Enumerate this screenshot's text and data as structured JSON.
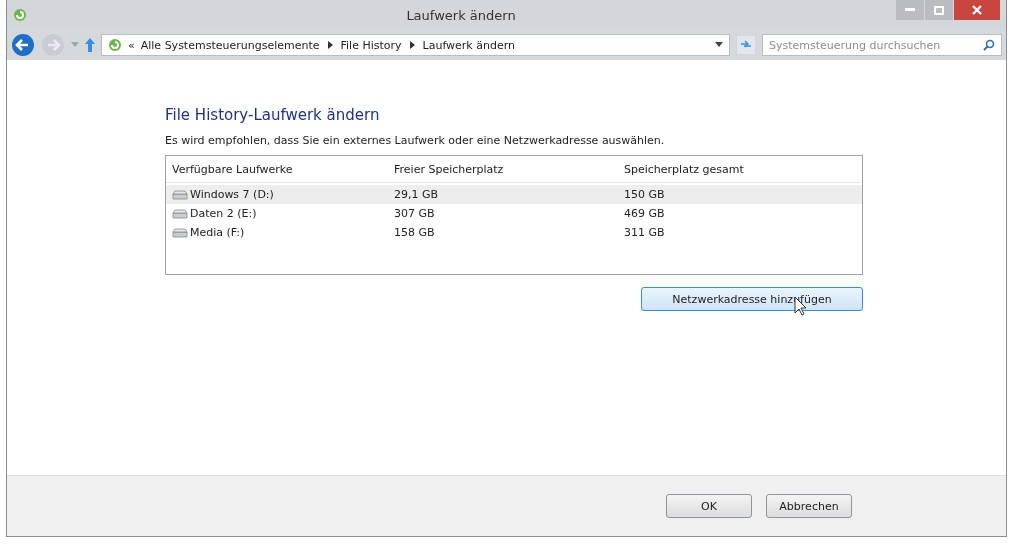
{
  "window": {
    "title": "Laufwerk ändern"
  },
  "address_bar": {
    "chevron": "«",
    "crumbs": [
      "Alle Systemsteuerungselemente",
      "File History",
      "Laufwerk ändern"
    ]
  },
  "search": {
    "placeholder": "Systemsteuerung durchsuchen"
  },
  "heading": "File History-Laufwerk ändern",
  "description": "Es wird empfohlen, dass Sie ein externes Laufwerk oder eine Netzwerkadresse auswählen.",
  "table": {
    "columns": [
      "Verfügbare Laufwerke",
      "Freier Speicherplatz",
      "Speicherplatz gesamt"
    ],
    "rows": [
      {
        "cells": [
          "Windows 7 (D:)",
          "29,1 GB",
          "150 GB"
        ],
        "selected": true
      },
      {
        "cells": [
          "Daten 2 (E:)",
          "307 GB",
          "469 GB"
        ],
        "selected": false
      },
      {
        "cells": [
          "Media (F:)",
          "158 GB",
          "311 GB"
        ],
        "selected": false
      }
    ]
  },
  "add_button": "Netzwerkadresse hinzufügen",
  "buttons": [
    "OK",
    "Abbrechen"
  ]
}
